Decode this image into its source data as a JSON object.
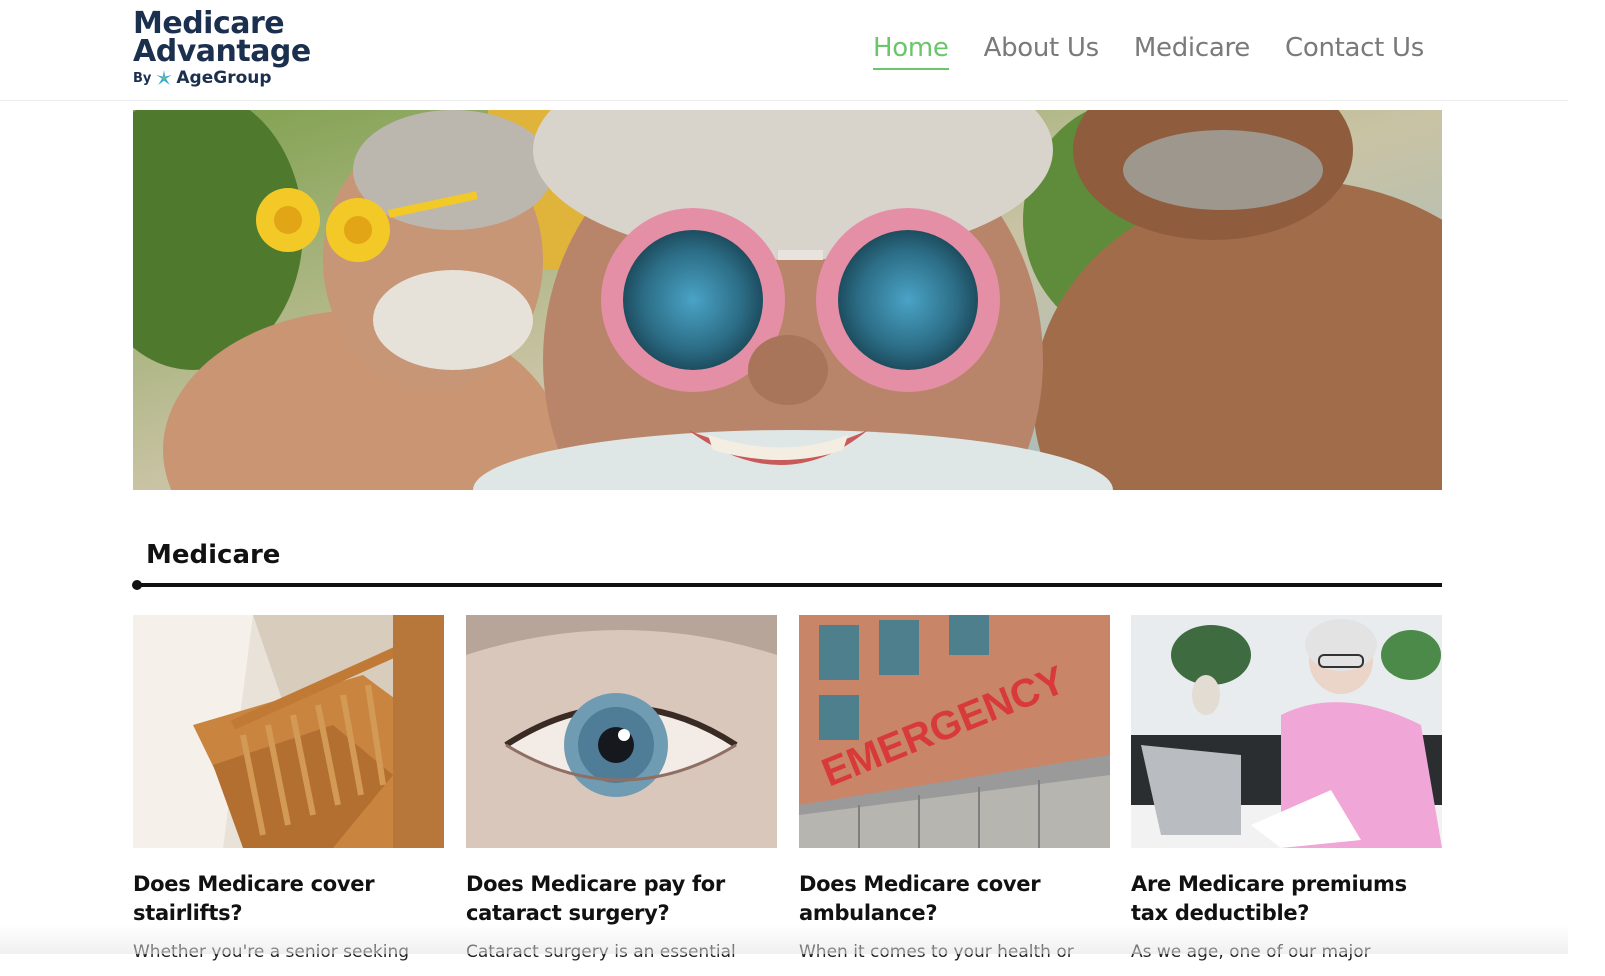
{
  "header": {
    "logo": {
      "line1": "Medicare",
      "line2": "Advantage",
      "by": "By",
      "brand": "AgeGroup"
    },
    "nav": [
      {
        "label": "Home",
        "active": true
      },
      {
        "label": "About Us",
        "active": false
      },
      {
        "label": "Medicare",
        "active": false
      },
      {
        "label": "Contact Us",
        "active": false
      }
    ]
  },
  "section": {
    "title": "Medicare"
  },
  "cards": [
    {
      "title": "Does Medicare cover stairlifts?",
      "excerpt": "Whether you're a senior seeking"
    },
    {
      "title": "Does Medicare pay for cataract surgery?",
      "excerpt": "Cataract surgery is an essential"
    },
    {
      "title": "Does Medicare cover ambulance?",
      "excerpt": "When it comes to your health or"
    },
    {
      "title": "Are Medicare premiums tax deductible?",
      "excerpt": "As we age, one of our major"
    }
  ],
  "images": {
    "card3_sign": "EMERGENCY"
  },
  "colors": {
    "brand_navy": "#1b2f4e",
    "nav_active": "#6cc56b",
    "nav_inactive": "#7a7a7a"
  }
}
